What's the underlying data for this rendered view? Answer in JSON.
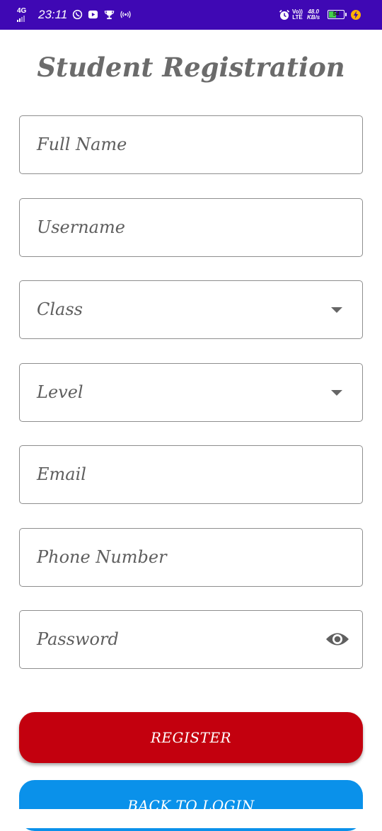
{
  "status_bar": {
    "network": "4G",
    "time": "23:11",
    "volte_top": "Vo))",
    "volte_bottom": "LTE",
    "speed_value": "48.0",
    "speed_unit": "KB/s",
    "battery": "54",
    "battery_level": 0.54,
    "icons": [
      "whatsapp-icon",
      "youtube-icon",
      "trophy-icon",
      "hotspot-icon",
      "alarm-icon",
      "charging-icon"
    ]
  },
  "page": {
    "title": "Student Registration"
  },
  "form": {
    "full_name": "Full Name",
    "username": "Username",
    "class": "Class",
    "level": "Level",
    "email": "Email",
    "phone": "Phone Number",
    "password": "Password"
  },
  "buttons": {
    "register": "REGISTER",
    "back_to_login": "BACK TO LOGIN"
  },
  "colors": {
    "status_bar": "#3f08b4",
    "register": "#c3000e",
    "back_to_login": "#0a91ea",
    "field_border": "#8e8e8e",
    "label_text": "#5e5e5e"
  }
}
